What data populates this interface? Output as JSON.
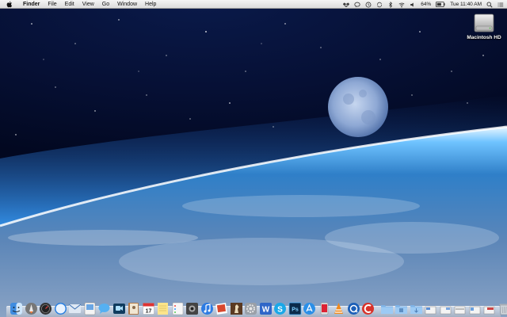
{
  "menubar": {
    "app_name": "Finder",
    "menus": [
      "File",
      "Edit",
      "View",
      "Go",
      "Window",
      "Help"
    ],
    "battery_percent": "64%",
    "clock": "Tue 11:40 AM"
  },
  "desktop": {
    "icons": [
      {
        "label": "Macintosh HD",
        "icon": "hard-drive-icon"
      }
    ]
  },
  "dock": {
    "apps": [
      "finder-icon",
      "launchpad-icon",
      "dashboard-icon",
      "safari-icon",
      "mail-icon",
      "preview-icon",
      "messages-icon",
      "facetime-icon",
      "contacts-icon",
      "calendar-icon",
      "notes-icon",
      "reminders-icon",
      "photo-booth-icon",
      "itunes-icon",
      "iphoto-icon",
      "chess-icon",
      "system-preferences-icon",
      "word-icon",
      "skype-icon",
      "photoshop-icon",
      "app-store-icon",
      "iphone-sync-icon",
      "vlc-icon",
      "quicktime-icon",
      "ccleaner-icon"
    ],
    "stacks": [
      "applications-folder-icon",
      "documents-folder-icon",
      "downloads-folder-icon",
      "stack-icon",
      "stack-icon",
      "stack-icon",
      "stack-icon",
      "stack-icon",
      "trash-icon"
    ]
  },
  "colors": {
    "menubar": "#e6e6e6",
    "space": "#020b24",
    "atmosphere": "#4fb2ff"
  }
}
